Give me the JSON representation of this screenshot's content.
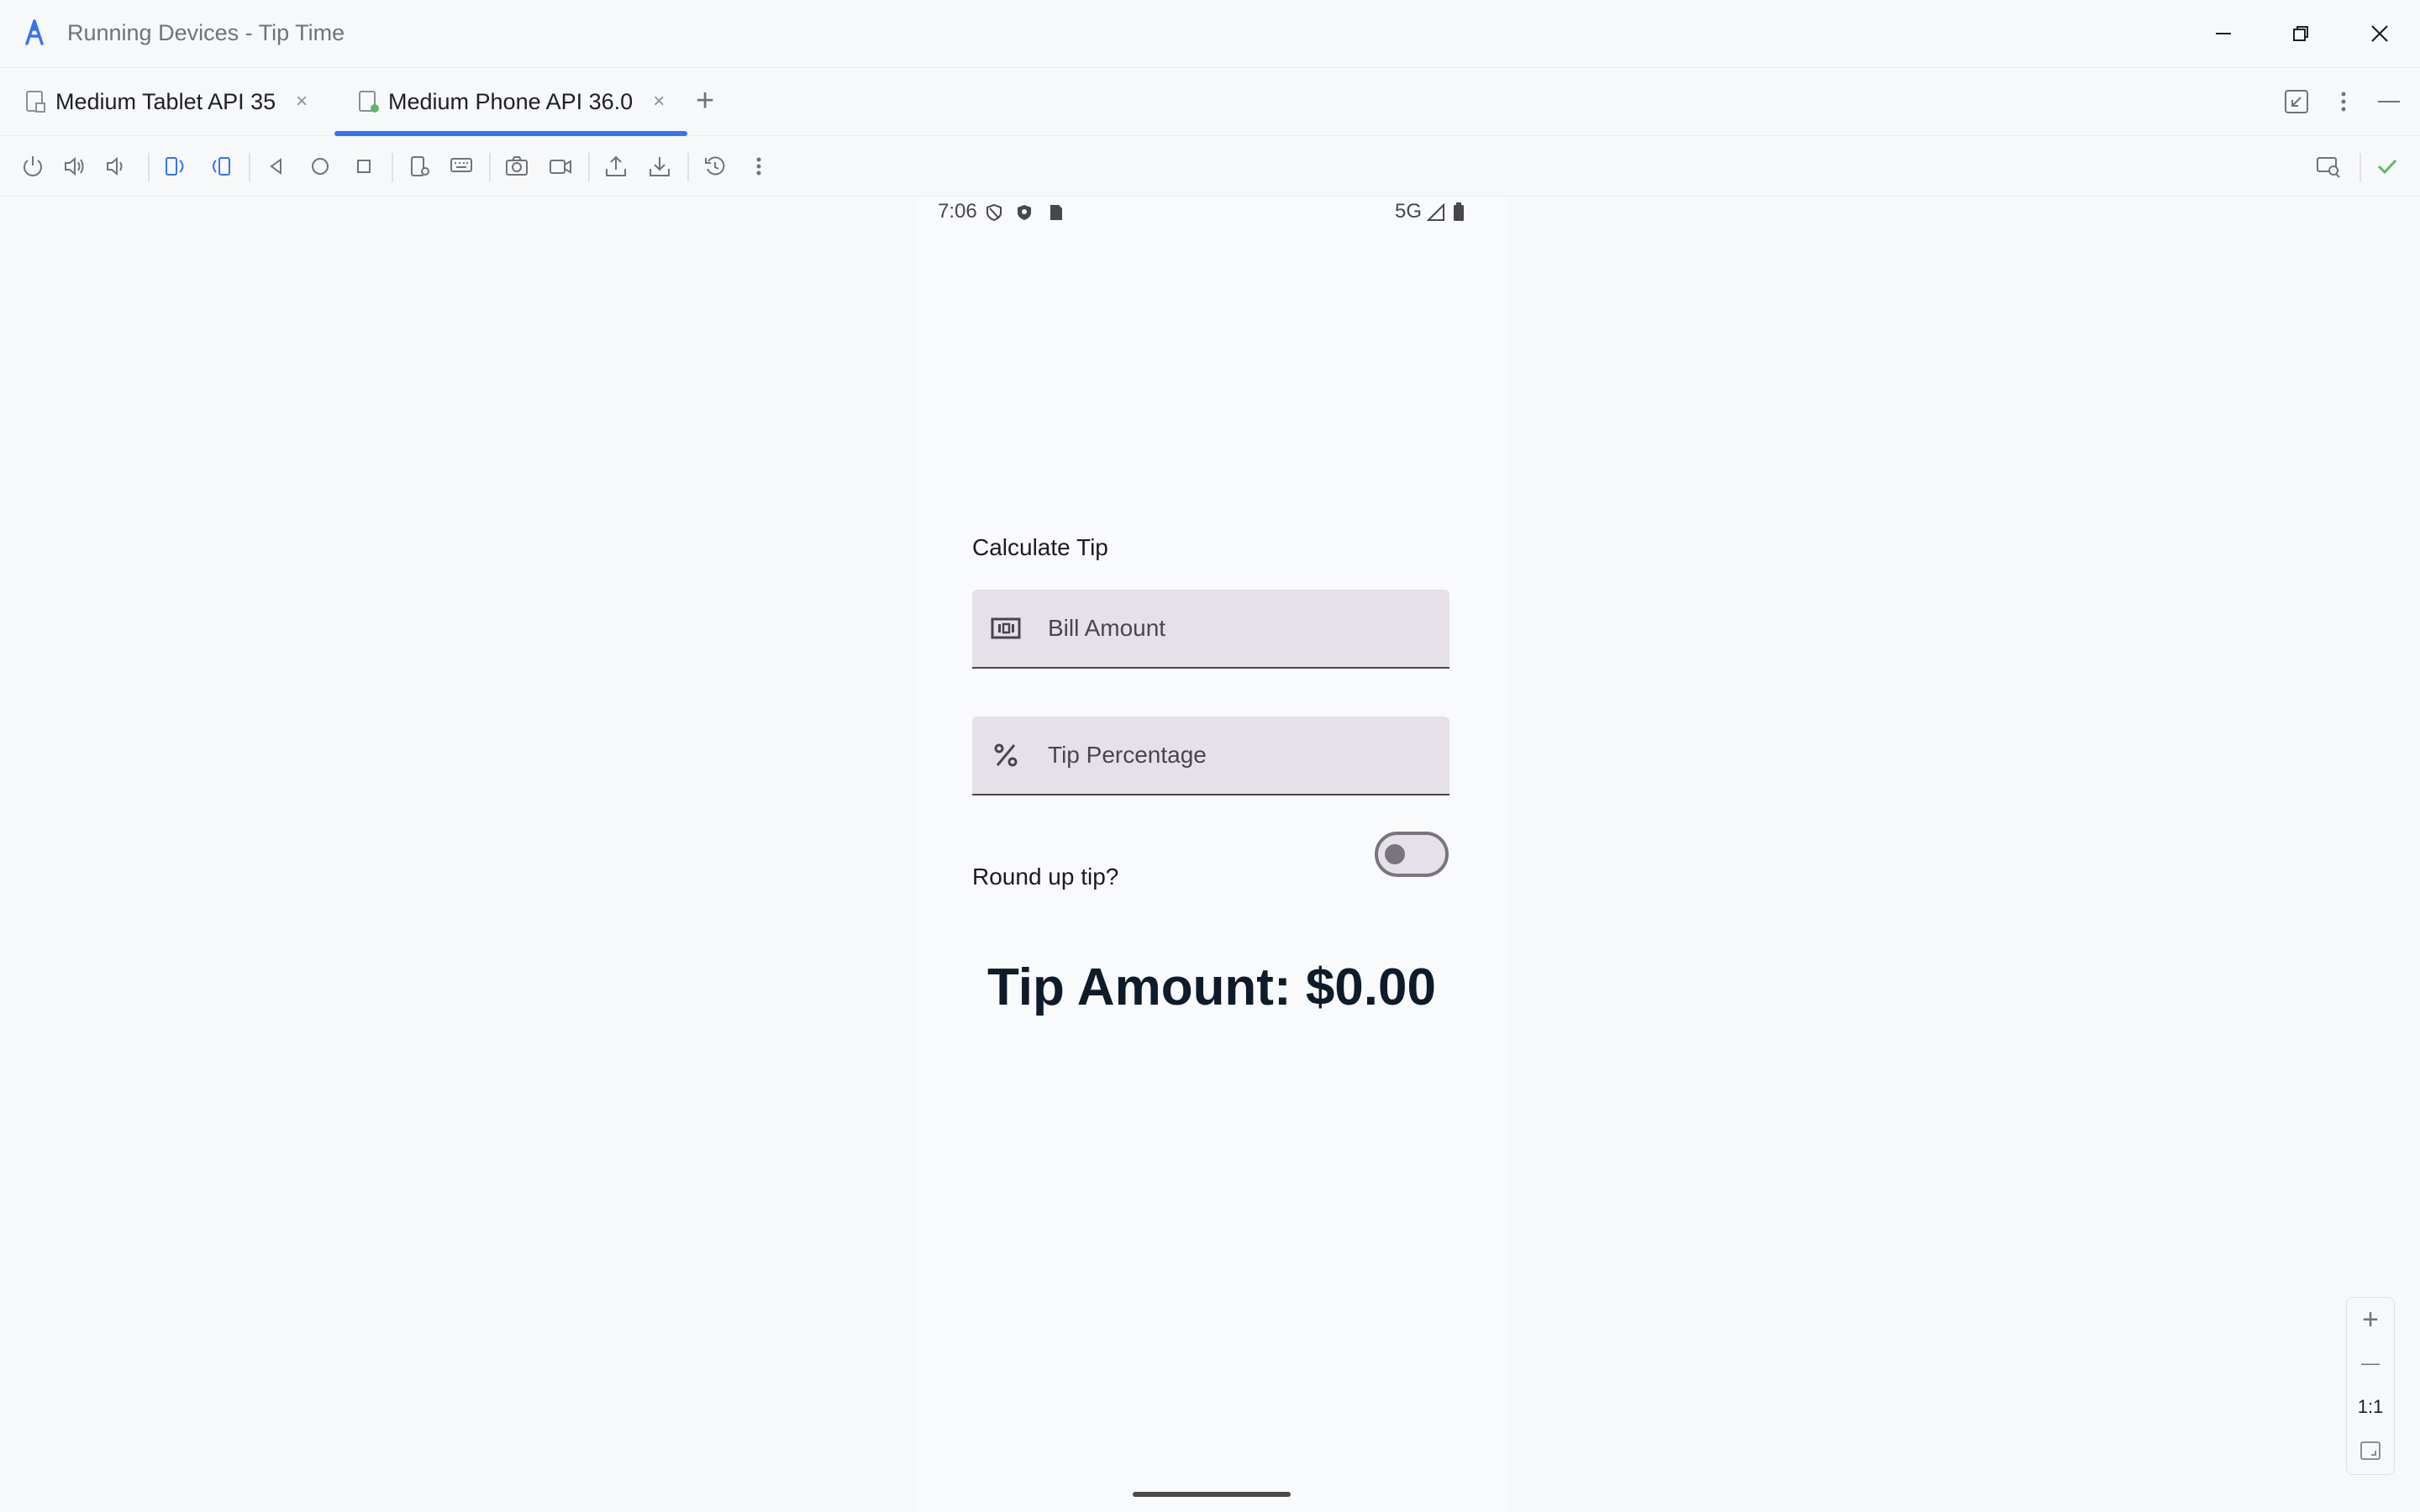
{
  "window": {
    "title": "Running Devices - Tip Time",
    "controls": [
      "minimize-icon",
      "restore-icon",
      "close-icon"
    ]
  },
  "tabs": [
    {
      "label": "Medium Tablet API 35",
      "active": false
    },
    {
      "label": "Medium Phone API 36.0",
      "active": true
    }
  ],
  "tab_close_glyph": "×",
  "add_tab_glyph": "+",
  "toolbar": {
    "icons": [
      "power-icon",
      "volume-up-icon",
      "volume-down-icon",
      "rotate-left-icon",
      "rotate-right-icon",
      "back-icon",
      "home-icon",
      "overview-icon",
      "device-settings-icon",
      "keyboard-icon",
      "screenshot-icon",
      "screen-record-icon",
      "push-file-icon",
      "pull-file-icon",
      "snapshot-icon",
      "more-icon"
    ],
    "right_icons": [
      "device-mirror-icon",
      "status-ok-icon"
    ]
  },
  "device": {
    "status_bar": {
      "time": "7:06",
      "network": "5G"
    },
    "app": {
      "title": "Calculate Tip",
      "bill_placeholder": "Bill Amount",
      "tip_placeholder": "Tip Percentage",
      "round_label": "Round up tip?",
      "round_enabled": false,
      "tip_amount": "Tip Amount: $0.00"
    }
  },
  "zoom": {
    "in": "+",
    "out": "—",
    "actual": "1:1"
  },
  "colors": {
    "accent": "#3574f0",
    "field_bg": "#e6e0e9",
    "ok": "#5fb865"
  }
}
